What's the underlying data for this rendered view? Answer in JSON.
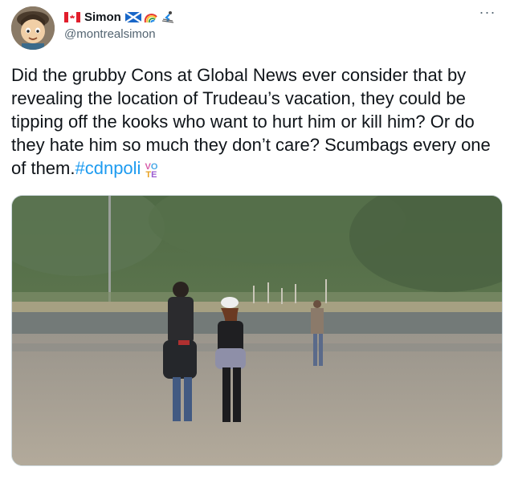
{
  "author": {
    "name": "Simon",
    "handle": "@montrealsimon",
    "avatar_icon": "cartoon-avatar-icon",
    "name_icons": [
      "canada-flag-icon",
      "scotland-flag-icon",
      "rainbow-icon",
      "skier-icon"
    ]
  },
  "tweet": {
    "text": "Did the grubby Cons at Global News ever consider that by revealing the location of Trudeau’s vacation, they could be tipping off the kooks who want to hurt him or kill him? Or do they hate him so much they don’t care? Scumbags every one of them.",
    "hashtag": "#cdnpoli",
    "vote_badge_top": "VO",
    "vote_badge_bottom": "TE"
  },
  "colors": {
    "text": "#0f1419",
    "secondary": "#536471",
    "link": "#1d9bf0"
  }
}
